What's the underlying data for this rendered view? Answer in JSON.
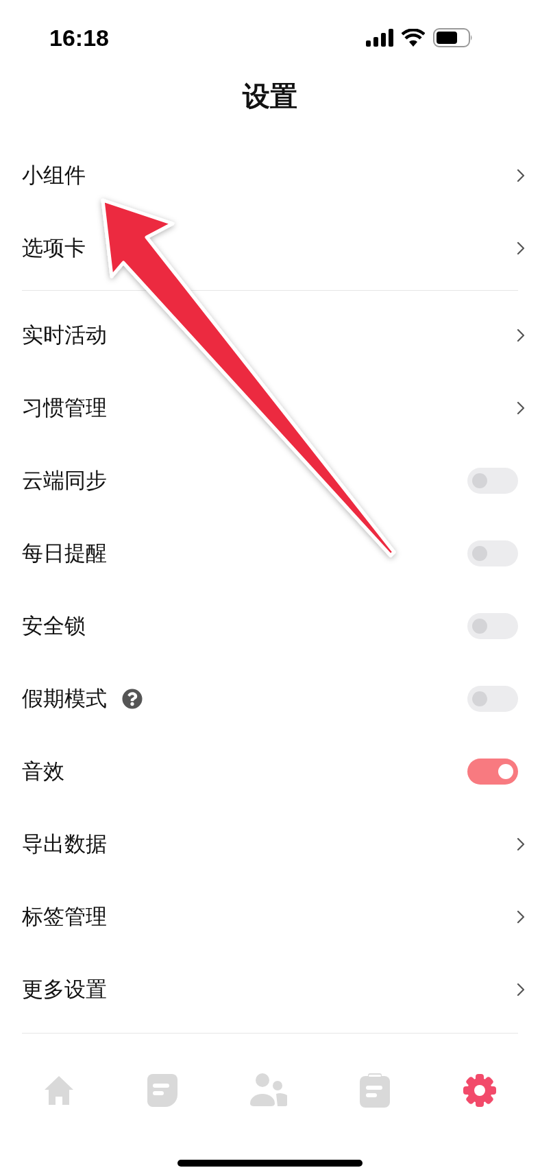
{
  "status_bar": {
    "time": "16:18"
  },
  "title": "设置",
  "groups": [
    {
      "rows": [
        {
          "label": "小组件",
          "kind": "link"
        },
        {
          "label": "选项卡",
          "kind": "link"
        }
      ]
    },
    {
      "rows": [
        {
          "label": "实时活动",
          "kind": "link"
        },
        {
          "label": "习惯管理",
          "kind": "link"
        },
        {
          "label": "云端同步",
          "kind": "toggle",
          "on": false
        },
        {
          "label": "每日提醒",
          "kind": "toggle",
          "on": false
        },
        {
          "label": "安全锁",
          "kind": "toggle",
          "on": false
        },
        {
          "label": "假期模式",
          "kind": "toggle",
          "on": false,
          "help": true
        },
        {
          "label": "音效",
          "kind": "toggle",
          "on": true
        },
        {
          "label": "导出数据",
          "kind": "link"
        },
        {
          "label": "标签管理",
          "kind": "link"
        },
        {
          "label": "更多设置",
          "kind": "link"
        }
      ]
    }
  ],
  "tab_bar": [
    {
      "selected": false
    },
    {
      "selected": false
    },
    {
      "selected": false
    },
    {
      "selected": false
    },
    {
      "selected": true
    }
  ]
}
